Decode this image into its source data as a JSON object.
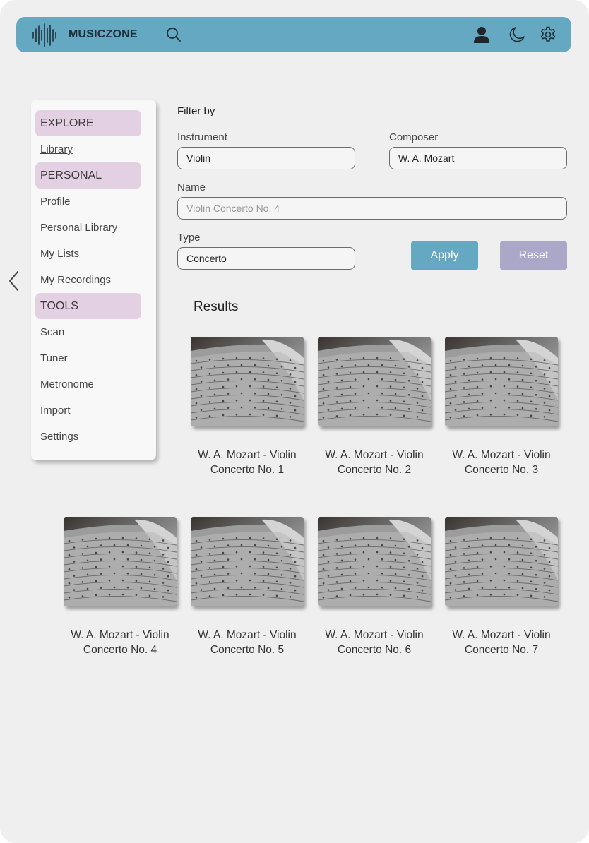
{
  "app": {
    "brand": "MUSICZONE"
  },
  "topbar": {
    "icons": [
      "waveform-logo-icon",
      "search-icon",
      "user-icon",
      "moon-icon",
      "gear-icon"
    ],
    "color": "#64a8c2"
  },
  "sidebar": {
    "sections": [
      {
        "heading": "EXPLORE",
        "items": [
          {
            "label": "Library",
            "active": true
          }
        ]
      },
      {
        "heading": "PERSONAL",
        "items": [
          {
            "label": "Profile"
          },
          {
            "label": "Personal Library"
          },
          {
            "label": "My Lists"
          },
          {
            "label": "My Recordings"
          }
        ]
      },
      {
        "heading": "TOOLS",
        "items": [
          {
            "label": "Scan"
          },
          {
            "label": "Tuner"
          },
          {
            "label": "Metronome"
          },
          {
            "label": "Import"
          },
          {
            "label": "Settings"
          }
        ]
      }
    ],
    "heading_color": "#e3d1e3"
  },
  "filter": {
    "title": "Filter by",
    "instrument": {
      "label": "Instrument",
      "value": "Violin"
    },
    "composer": {
      "label": "Composer",
      "value": "W. A. Mozart"
    },
    "name": {
      "label": "Name",
      "placeholder": "Violin Concerto No. 4"
    },
    "type": {
      "label": "Type",
      "value": "Concerto"
    },
    "apply_label": "Apply",
    "reset_label": "Reset",
    "apply_color": "#64a8c2",
    "reset_color": "#aaa7c8"
  },
  "results": {
    "title": "Results",
    "items": [
      {
        "line1": "W. A. Mozart - Violin",
        "line2": "Concerto No. 1"
      },
      {
        "line1": "W. A. Mozart - Violin",
        "line2": "Concerto No. 2"
      },
      {
        "line1": "W. A. Mozart - Violin",
        "line2": "Concerto No. 3"
      },
      {
        "line1": "W. A. Mozart - Violin",
        "line2": "Concerto No. 4"
      },
      {
        "line1": "W. A. Mozart - Violin",
        "line2": "Concerto No. 5"
      },
      {
        "line1": "W. A. Mozart - Violin",
        "line2": "Concerto No. 6"
      },
      {
        "line1": "W. A. Mozart - Violin",
        "line2": "Concerto No. 7"
      }
    ]
  }
}
